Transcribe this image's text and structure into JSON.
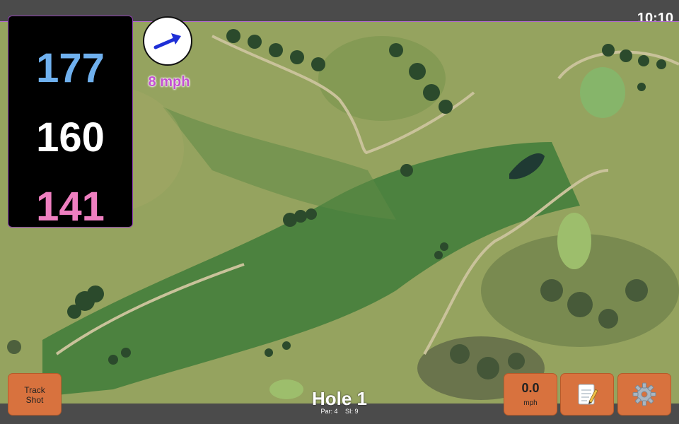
{
  "status": {
    "clock": "10:10"
  },
  "distances": {
    "back": "177",
    "middle": "160",
    "front": "141"
  },
  "wind": {
    "speed_label": "8 mph",
    "arrow_icon": "wind-direction-arrow-icon"
  },
  "hole": {
    "title": "Hole 1",
    "par": "Par: 4",
    "si": "SI: 9"
  },
  "buttons": {
    "track_shot_line1": "Track",
    "track_shot_line2": "Shot",
    "wind_value": "0.0",
    "wind_unit": "mph",
    "notes_icon": "notepad-icon",
    "settings_icon": "gear-icon"
  },
  "colors": {
    "back_distance": "#6fb0ee",
    "middle_distance": "#ffffff",
    "front_distance": "#ee7fc0",
    "button": "#d8723e",
    "wind_text": "#c44fd2",
    "panel_border": "#8e3fb2"
  }
}
